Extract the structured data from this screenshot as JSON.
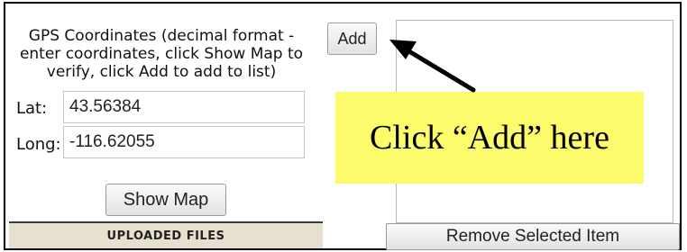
{
  "gps": {
    "instructions": "GPS Coordinates (decimal format - enter coordinates, click Show Map to verify, click Add to add to list)",
    "lat_label": "Lat:",
    "lat_value": "43.56384",
    "long_label": "Long:",
    "long_value": "-116.62055",
    "show_map_label": "Show Map",
    "add_label": "Add"
  },
  "uploaded_files_label": "UPLOADED FILES",
  "remove_selected_label": "Remove Selected Item",
  "callout_text": "Click “Add” here",
  "colors": {
    "callout_bg": "#fbfb6b",
    "uploaded_bar_bg": "#e7dfcf"
  }
}
